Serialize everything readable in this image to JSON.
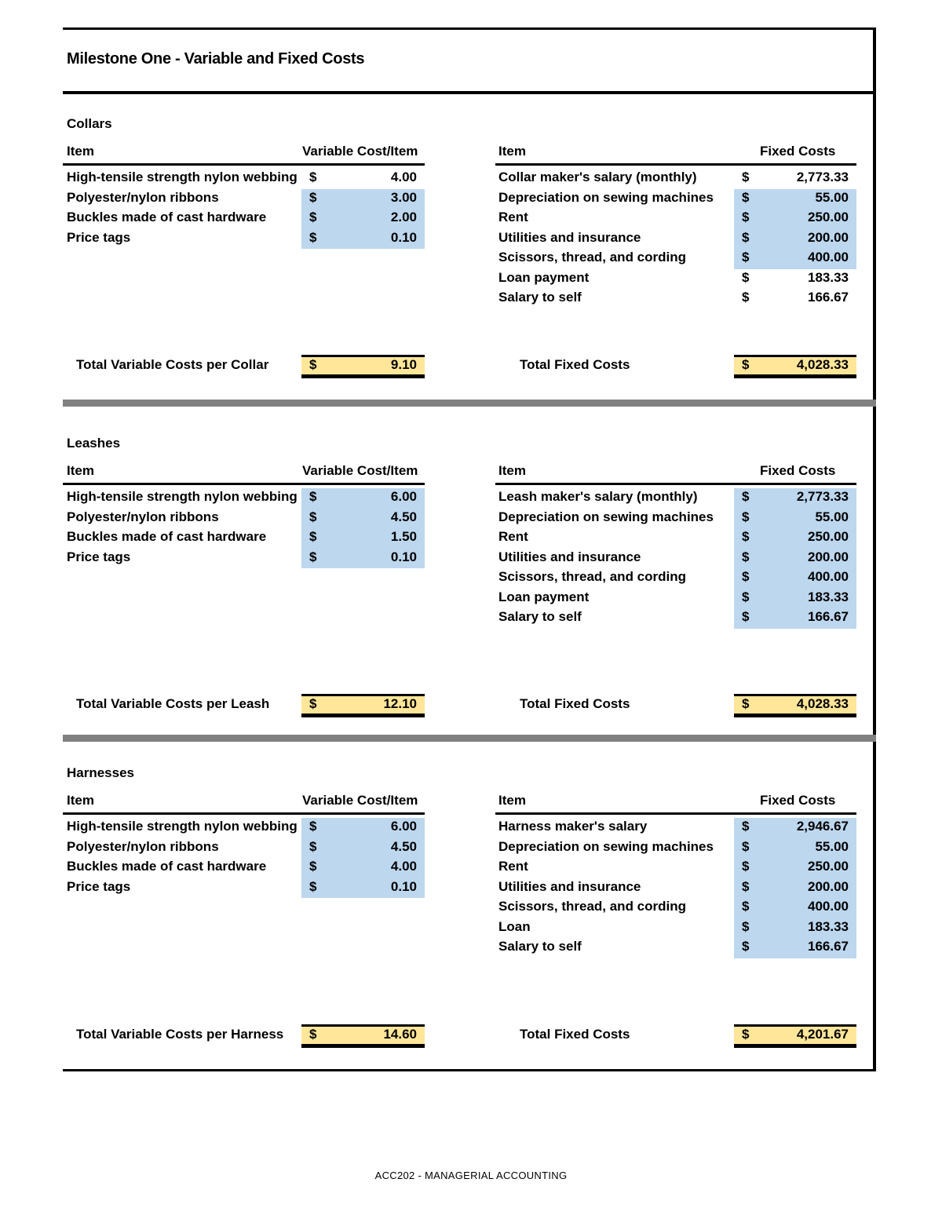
{
  "document": {
    "title": "Milestone One - Variable and Fixed Costs",
    "footer": "ACC202 - MANAGERIAL ACCOUNTING",
    "colors": {
      "input_fill": "#bdd7ee",
      "total_fill": "#ffe699",
      "separator": "#808080"
    }
  },
  "sections": [
    {
      "name": "Collars",
      "variable_header": {
        "item": "Item",
        "value": "Variable Cost/Item"
      },
      "variable_rows": [
        {
          "item": "High-tensile strength nylon webbing",
          "currency": "$",
          "value": "4.00",
          "highlighted": false
        },
        {
          "item": "Polyester/nylon ribbons",
          "currency": "$",
          "value": "3.00",
          "highlighted": true
        },
        {
          "item": "Buckles made of cast hardware",
          "currency": "$",
          "value": "2.00",
          "highlighted": true
        },
        {
          "item": "Price tags",
          "currency": "$",
          "value": "0.10",
          "highlighted": true
        }
      ],
      "fixed_header": {
        "item": "Item",
        "value": "Fixed Costs"
      },
      "fixed_rows": [
        {
          "item": "Collar maker's salary (monthly)",
          "currency": "$",
          "value": "2,773.33",
          "highlighted": false
        },
        {
          "item": "Depreciation on sewing machines",
          "currency": "$",
          "value": "55.00",
          "highlighted": true
        },
        {
          "item": "Rent",
          "currency": "$",
          "value": "250.00",
          "highlighted": true
        },
        {
          "item": "Utilities and insurance",
          "currency": "$",
          "value": "200.00",
          "highlighted": true
        },
        {
          "item": "Scissors, thread, and cording",
          "currency": "$",
          "value": "400.00",
          "highlighted": true
        },
        {
          "item": "Loan payment",
          "currency": "$",
          "value": "183.33",
          "highlighted": false
        },
        {
          "item": "Salary to self",
          "currency": "$",
          "value": "166.67",
          "highlighted": false
        }
      ],
      "total_variable": {
        "label": "Total Variable Costs per Collar",
        "currency": "$",
        "value": "9.10"
      },
      "total_fixed": {
        "label": "Total Fixed Costs",
        "currency": "$",
        "value": "4,028.33"
      }
    },
    {
      "name": "Leashes",
      "variable_header": {
        "item": "Item",
        "value": "Variable Cost/Item"
      },
      "variable_rows": [
        {
          "item": "High-tensile strength nylon webbing",
          "currency": "$",
          "value": "6.00",
          "highlighted": true
        },
        {
          "item": "Polyester/nylon ribbons",
          "currency": "$",
          "value": "4.50",
          "highlighted": true
        },
        {
          "item": "Buckles made of cast hardware",
          "currency": "$",
          "value": "1.50",
          "highlighted": true
        },
        {
          "item": "Price tags",
          "currency": "$",
          "value": "0.10",
          "highlighted": true
        }
      ],
      "fixed_header": {
        "item": "Item",
        "value": "Fixed Costs"
      },
      "fixed_rows": [
        {
          "item": "Leash maker's salary (monthly)",
          "currency": "$",
          "value": "2,773.33",
          "highlighted": true
        },
        {
          "item": "Depreciation on sewing machines",
          "currency": "$",
          "value": "55.00",
          "highlighted": true
        },
        {
          "item": "Rent",
          "currency": "$",
          "value": "250.00",
          "highlighted": true
        },
        {
          "item": "Utilities and insurance",
          "currency": "$",
          "value": "200.00",
          "highlighted": true
        },
        {
          "item": "Scissors, thread, and cording",
          "currency": "$",
          "value": "400.00",
          "highlighted": true
        },
        {
          "item": "Loan payment",
          "currency": "$",
          "value": "183.33",
          "highlighted": true
        },
        {
          "item": "Salary to self",
          "currency": "$",
          "value": "166.67",
          "highlighted": true
        }
      ],
      "total_variable": {
        "label": "Total Variable Costs per Leash",
        "currency": "$",
        "value": "12.10"
      },
      "total_fixed": {
        "label": "Total Fixed Costs",
        "currency": "$",
        "value": "4,028.33"
      }
    },
    {
      "name": "Harnesses",
      "variable_header": {
        "item": "Item",
        "value": "Variable Cost/Item"
      },
      "variable_rows": [
        {
          "item": "High-tensile strength nylon webbing",
          "currency": "$",
          "value": "6.00",
          "highlighted": true
        },
        {
          "item": "Polyester/nylon ribbons",
          "currency": "$",
          "value": "4.50",
          "highlighted": true
        },
        {
          "item": "Buckles made of cast hardware",
          "currency": "$",
          "value": "4.00",
          "highlighted": true
        },
        {
          "item": "Price tags",
          "currency": "$",
          "value": "0.10",
          "highlighted": true
        }
      ],
      "fixed_header": {
        "item": "Item",
        "value": "Fixed Costs"
      },
      "fixed_rows": [
        {
          "item": "Harness maker's salary",
          "currency": "$",
          "value": "2,946.67",
          "highlighted": true
        },
        {
          "item": "Depreciation on sewing machines",
          "currency": "$",
          "value": "55.00",
          "highlighted": true
        },
        {
          "item": "Rent",
          "currency": "$",
          "value": "250.00",
          "highlighted": true
        },
        {
          "item": "Utilities and insurance",
          "currency": "$",
          "value": "200.00",
          "highlighted": true
        },
        {
          "item": "Scissors, thread, and cording",
          "currency": "$",
          "value": "400.00",
          "highlighted": true
        },
        {
          "item": "Loan",
          "currency": "$",
          "value": "183.33",
          "highlighted": true
        },
        {
          "item": "Salary to self",
          "currency": "$",
          "value": "166.67",
          "highlighted": true
        }
      ],
      "total_variable": {
        "label": "Total Variable Costs per Harness",
        "currency": "$",
        "value": "14.60"
      },
      "total_fixed": {
        "label": "Total Fixed Costs",
        "currency": "$",
        "value": "4,201.67"
      }
    }
  ]
}
